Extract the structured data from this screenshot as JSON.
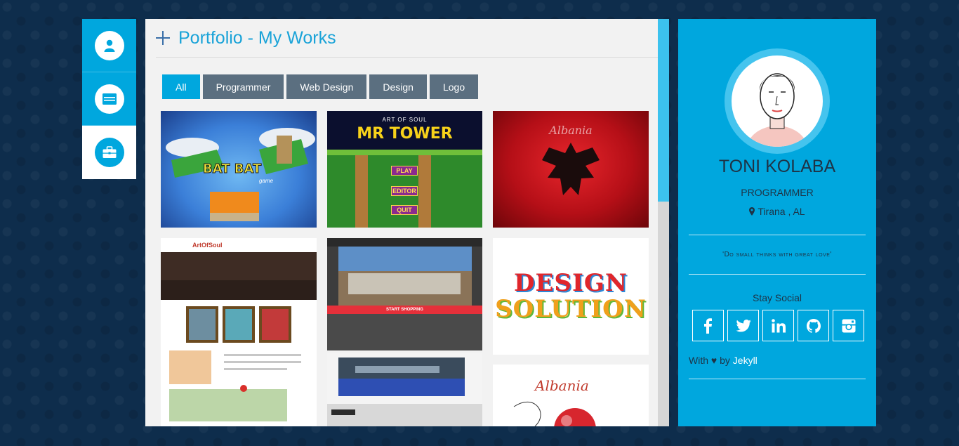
{
  "nav": {
    "tabs": [
      {
        "name": "about",
        "icon": "user-icon"
      },
      {
        "name": "resume",
        "icon": "card-icon"
      },
      {
        "name": "portfolio",
        "icon": "briefcase-icon"
      }
    ],
    "active": "portfolio"
  },
  "portfolio": {
    "title": "Portfolio - My Works",
    "filters": [
      "All",
      "Programmer",
      "Web Design",
      "Design",
      "Logo"
    ],
    "active_filter": "All",
    "tiles": {
      "batbat": {
        "title": "BAT BAT",
        "subtitle": "game"
      },
      "mrtower": {
        "eyebrow": "ART OF SOUL",
        "title": "MR TOWER",
        "play": "PLAY",
        "editor": "EDITOR",
        "quit": "QUIT"
      },
      "artofsoul": {
        "logo": "ArtOfSoul"
      },
      "shop": {
        "banner": "START SHOPPING"
      },
      "design": {
        "line1": "DESIGN",
        "line2": "SOLUTION"
      },
      "albania": {
        "text": "Albania"
      }
    }
  },
  "profile": {
    "name": "TONI KOLABA",
    "role": "PROGRAMMER",
    "location": "Tirana , AL",
    "quote": "'Do small thinks with great love'",
    "stay_social": "Stay Social",
    "socials": [
      "facebook-icon",
      "twitter-icon",
      "linkedin-icon",
      "github-icon",
      "instagram-icon"
    ],
    "credit_prefix": "With",
    "credit_heart": "♥",
    "credit_by": "by",
    "credit_link": "Jekyll"
  },
  "colors": {
    "accent": "#00a7de",
    "background": "#0e2d4c",
    "filter_inactive": "#5b6f80",
    "text_dark": "#1e3346"
  }
}
